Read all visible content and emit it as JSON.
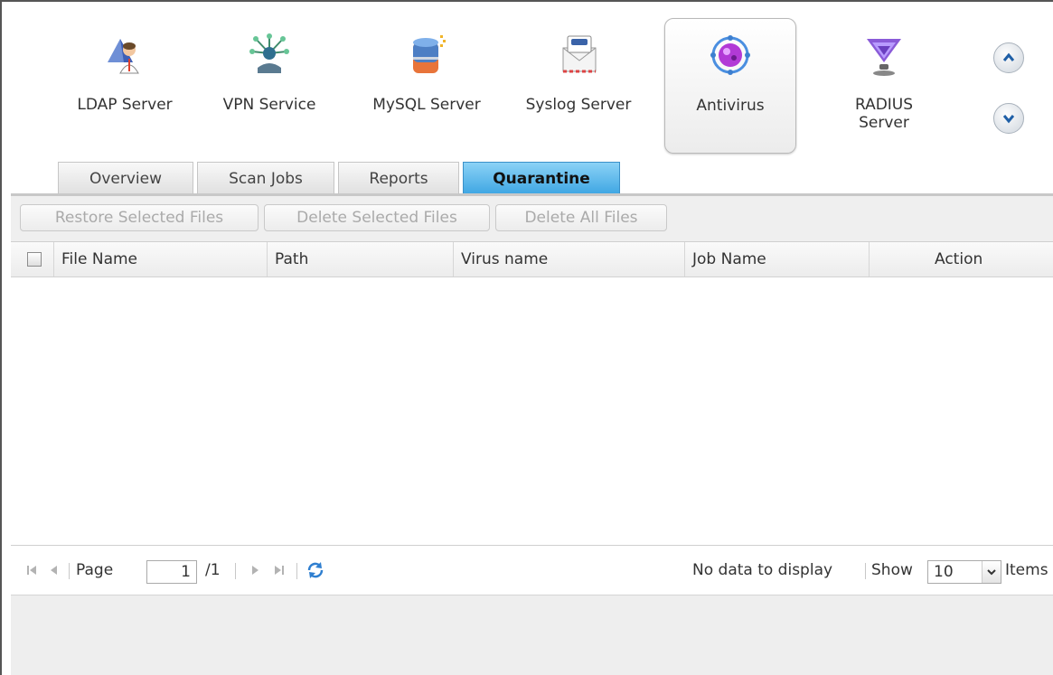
{
  "apps": [
    {
      "label": "LDAP Server",
      "icon": "ldap-server-icon"
    },
    {
      "label": "VPN Service",
      "icon": "vpn-service-icon"
    },
    {
      "label": "MySQL Server",
      "icon": "mysql-server-icon"
    },
    {
      "label": "Syslog Server",
      "icon": "syslog-server-icon"
    },
    {
      "label": "Antivirus",
      "icon": "antivirus-icon",
      "selected": true
    },
    {
      "label": "RADIUS Server",
      "icon": "radius-server-icon"
    }
  ],
  "tabs": [
    {
      "label": "Overview"
    },
    {
      "label": "Scan Jobs"
    },
    {
      "label": "Reports"
    },
    {
      "label": "Quarantine",
      "active": true
    }
  ],
  "toolbar": {
    "restore_label": "Restore Selected Files",
    "delete_selected_label": "Delete Selected Files",
    "delete_all_label": "Delete All Files"
  },
  "grid": {
    "columns": [
      "File Name",
      "Path",
      "Virus name",
      "Job Name",
      "Action"
    ],
    "rows": []
  },
  "paging": {
    "page_label": "Page",
    "current_page": "1",
    "total_pages": "/1",
    "status": "No data to display",
    "show_label": "Show",
    "page_size": "10",
    "items_label": "Items"
  },
  "colors": {
    "active_tab": "#3ea6e3",
    "refresh_icon": "#2f7fd0"
  }
}
